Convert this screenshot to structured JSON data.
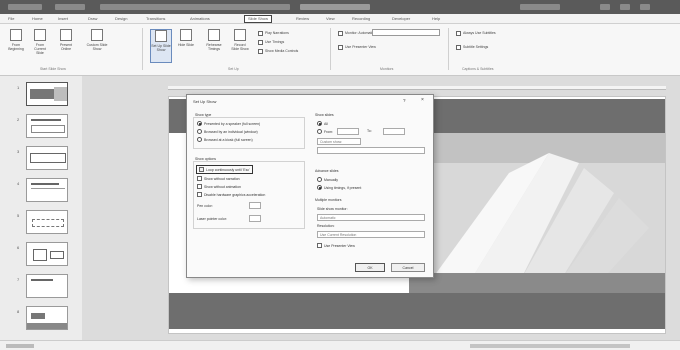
{
  "window": {
    "title_text": ""
  },
  "ribbon_tabs": [
    "File",
    "Home",
    "Insert",
    "Draw",
    "Design",
    "Transitions",
    "Animations",
    "Slide Show",
    "Review",
    "View",
    "Recording",
    "Developer",
    "Help"
  ],
  "active_tab_index": 7,
  "ribbon": {
    "groups": [
      {
        "name": "Start Slide Show",
        "buttons": [
          "From Beginning",
          "From Current Slide",
          "Present Online",
          "Custom Slide Show"
        ]
      },
      {
        "name": "Set Up",
        "buttons": [
          "Set Up Slide Show",
          "Hide Slide",
          "Rehearse Timings",
          "Record Slide Show"
        ],
        "checks": [
          "Play Narrations",
          "Use Timings",
          "Show Media Controls"
        ]
      },
      {
        "name": "Monitors",
        "checks": [
          "Monitor: Automatic",
          "Use Presenter View"
        ]
      },
      {
        "name": "Captions & Subtitles",
        "checks": [
          "Always Use Subtitles",
          "Subtitle Settings"
        ]
      }
    ]
  },
  "thumbnails": [
    1,
    2,
    3,
    4,
    5,
    6,
    7,
    8
  ],
  "selected_thumbnail": 1,
  "dialog": {
    "title": "Set Up Show",
    "show_type_label": "Show type",
    "show_type_options": [
      "Presented by a speaker (full screen)",
      "Browsed by an individual (window)",
      "Browsed at a kiosk (full screen)"
    ],
    "show_type_selected": 0,
    "show_options_label": "Show options",
    "show_options": [
      "Loop continuously until 'Esc'",
      "Show without narration",
      "Show without animation",
      "Disable hardware graphics acceleration"
    ],
    "show_options_checked": [
      0
    ],
    "pen_color_label": "Pen color:",
    "laser_color_label": "Laser pointer color:",
    "show_slides_label": "Show slides",
    "show_slides_options": [
      "All",
      "From:"
    ],
    "show_slides_selected": 0,
    "to_label": "To:",
    "custom_show_placeholder": "Custom show:",
    "advance_label": "Advance slides",
    "advance_options": [
      "Manually",
      "Using timings, if present"
    ],
    "advance_selected": 1,
    "multiple_monitors_label": "Multiple monitors",
    "slide_monitor_label": "Slide show monitor:",
    "monitor_value": "Automatic",
    "resolution_label": "Resolution:",
    "resolution_value": "Use Current Resolution",
    "presenter_view_label": "Use Presenter View",
    "ok_label": "OK",
    "cancel_label": "Cancel",
    "help_glyph": "?",
    "close_glyph": "×"
  },
  "colors": {
    "accent": "#6a8bbd",
    "ribbon_bg": "#f7f7f7",
    "dialog_bg": "#fafafa",
    "slide_band": "#6e6e6e"
  }
}
